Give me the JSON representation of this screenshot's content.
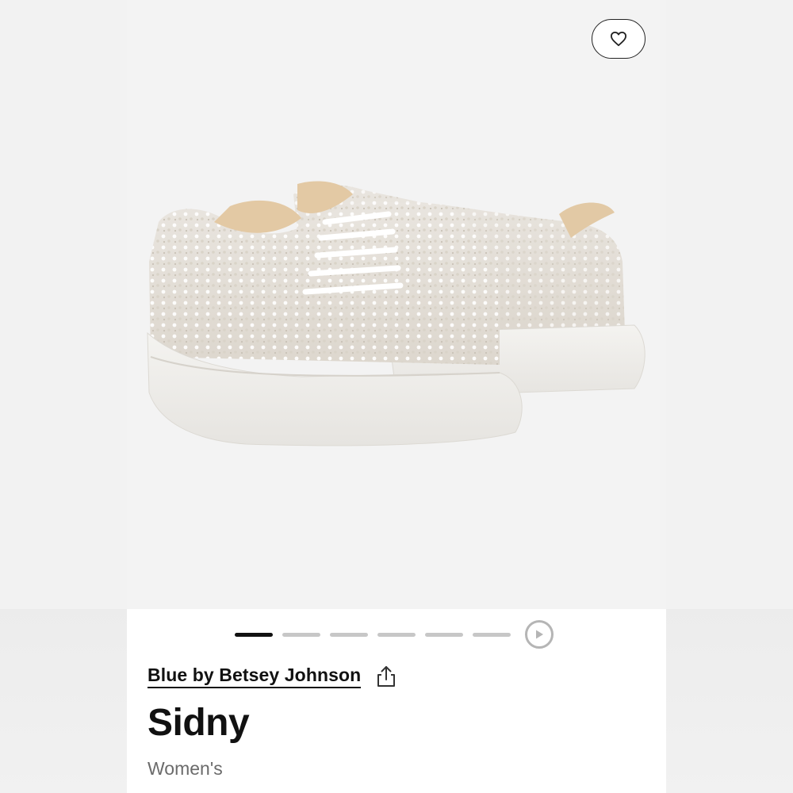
{
  "product": {
    "brand": "Blue by Betsey Johnson",
    "name": "Sidny",
    "gender": "Women's"
  },
  "gallery": {
    "total_images": 6,
    "active_index": 0,
    "image_subject": "pair of white pearl-embellished platform sneakers"
  },
  "icons": {
    "favorite": "heart-icon",
    "share": "share-icon",
    "play": "play-icon"
  },
  "colors": {
    "text_primary": "#111111",
    "text_secondary": "#6b6b6b",
    "pager_active": "#111111",
    "pager_inactive": "#c7c7c7"
  }
}
